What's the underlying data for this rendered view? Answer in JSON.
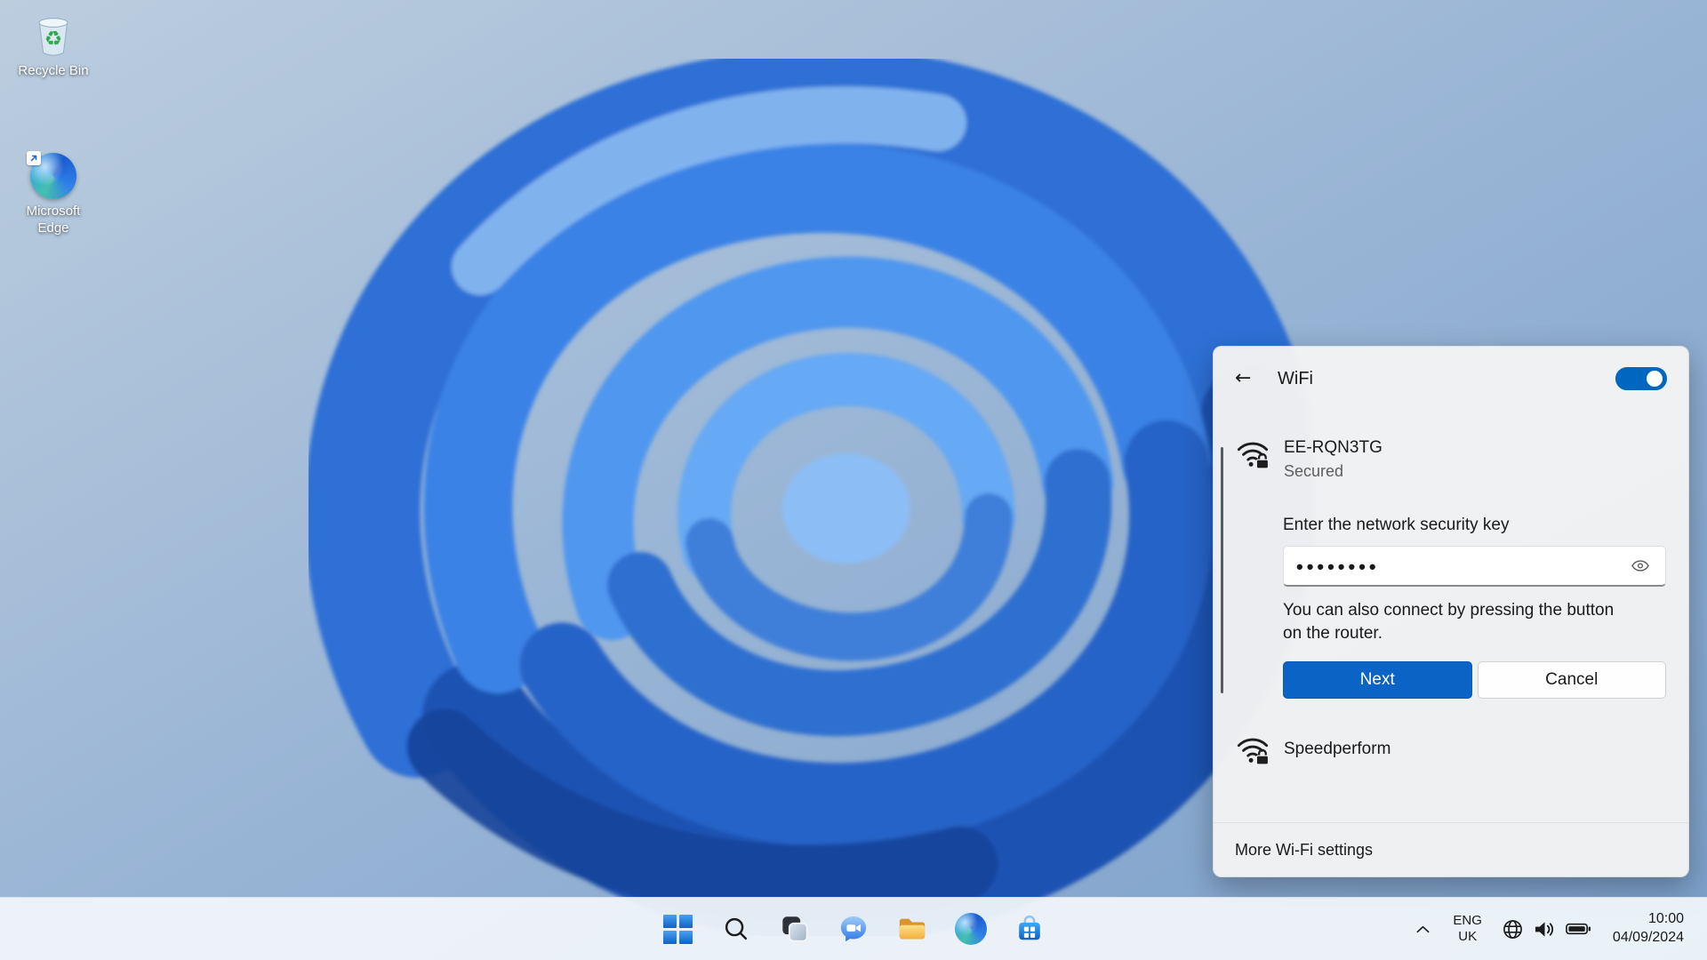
{
  "icons": {
    "back_arrow": "←"
  },
  "desktop": {
    "icons": [
      {
        "label": "Recycle Bin"
      },
      {
        "label": "Microsoft Edge"
      }
    ]
  },
  "wifi_panel": {
    "title": "WiFi",
    "toggle_state": "on",
    "selected_network": {
      "name": "EE-RQN3TG",
      "status": "Secured",
      "prompt": "Enter the network security key",
      "password_masked": "••••••••",
      "hint": "You can also connect by pressing the button on the router.",
      "next_label": "Next",
      "cancel_label": "Cancel"
    },
    "other_networks": [
      {
        "name": "Speedperform"
      }
    ],
    "footer_link": "More Wi-Fi settings"
  },
  "taskbar": {
    "tray": {
      "language": "ENG",
      "region": "UK",
      "time": "10:00",
      "date": "04/09/2024"
    }
  },
  "colors": {
    "accent": "#0067c0",
    "next_button": "#0b63c5",
    "panel_bg": "#f3f3f3",
    "taskbar_bg": "#f1f5fa"
  }
}
